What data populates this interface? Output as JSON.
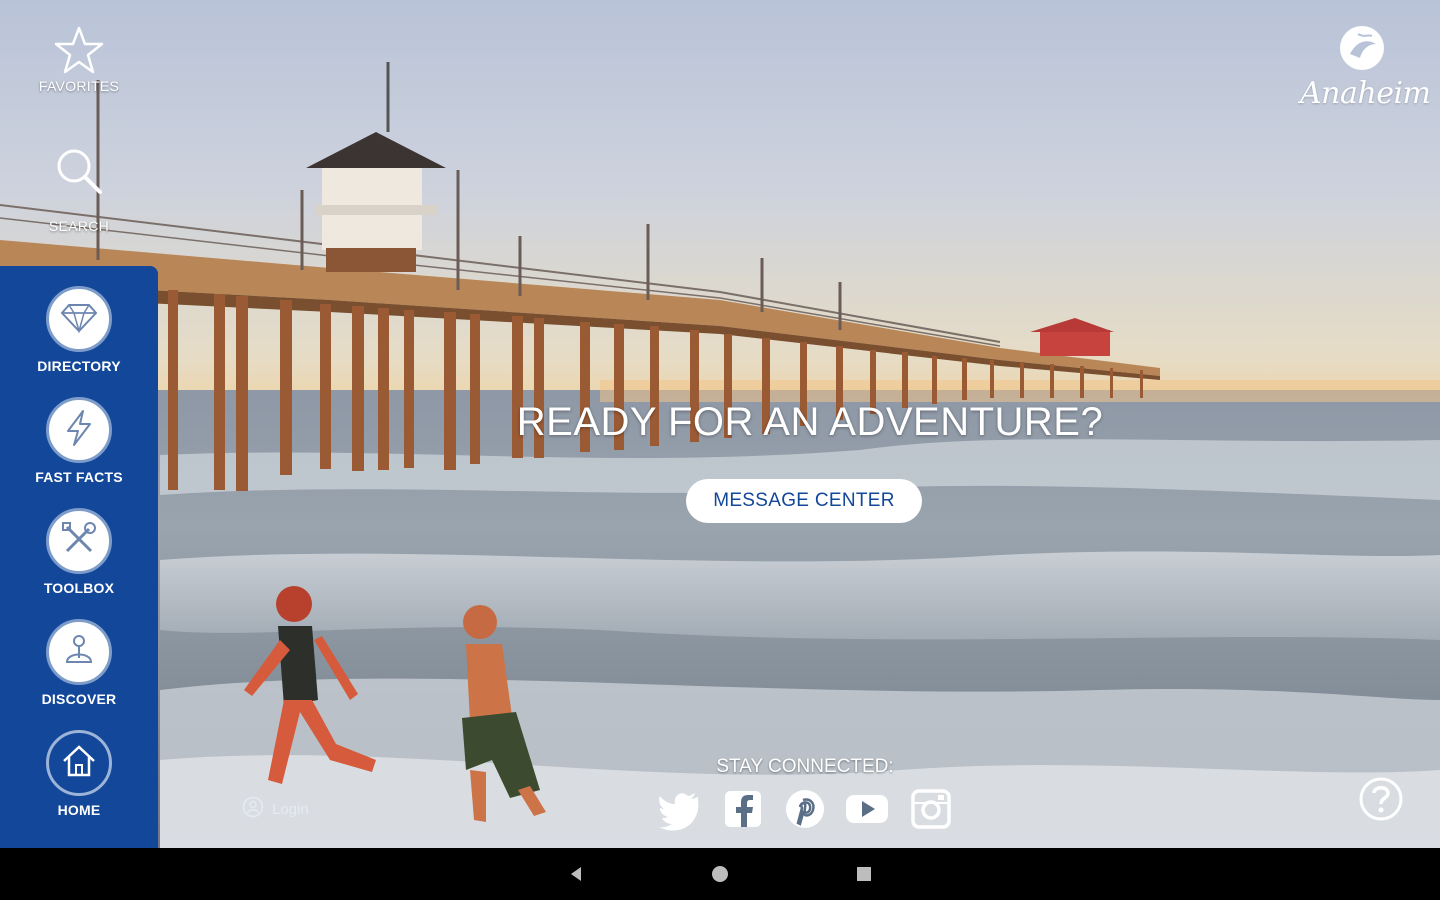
{
  "top_links": {
    "favorites_label": "FAVORITES",
    "search_label": "SEARCH"
  },
  "sidebar": {
    "items": [
      {
        "label": "DIRECTORY",
        "icon": "diamond-icon"
      },
      {
        "label": "FAST FACTS",
        "icon": "lightning-icon"
      },
      {
        "label": "TOOLBOX",
        "icon": "wrench-screwdriver-icon"
      },
      {
        "label": "DISCOVER",
        "icon": "discover-icon"
      },
      {
        "label": "HOME",
        "icon": "home-icon"
      }
    ]
  },
  "logo": {
    "text": "Anaheim"
  },
  "hero": {
    "headline": "READY FOR AN ADVENTURE?",
    "button_label": "MESSAGE CENTER"
  },
  "footer": {
    "stay_connected": "STAY CONNECTED:",
    "login_label": "Login",
    "social_icons": [
      "twitter-icon",
      "facebook-icon",
      "pinterest-icon",
      "youtube-icon",
      "instagram-icon"
    ]
  },
  "colors": {
    "sidebar_bg": "#12479a",
    "accent_text": "#12479a",
    "white": "#ffffff"
  }
}
